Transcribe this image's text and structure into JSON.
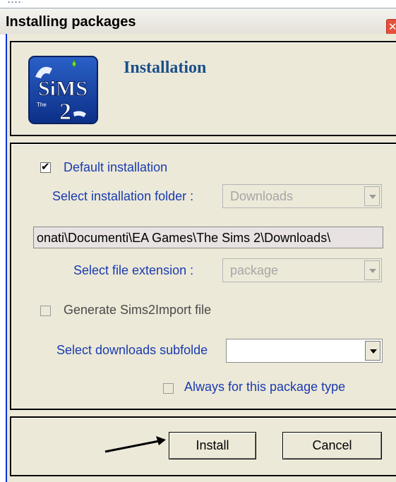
{
  "window": {
    "title": "Installing packages",
    "close_glyph": "✕"
  },
  "header": {
    "logo_text": "The Sims 2",
    "heading": "Installation"
  },
  "options": {
    "default_installation": {
      "label": "Default installation",
      "checked": true
    },
    "install_folder": {
      "label": "Select installation folder :",
      "value": "Downloads"
    },
    "path": "onati\\Documenti\\EA Games\\The Sims 2\\Downloads\\",
    "file_extension": {
      "label": "Select file extension :",
      "value": "package"
    },
    "generate_import": {
      "label": "Generate Sims2Import file",
      "checked": false
    },
    "downloads_subfolder": {
      "label": "Select downloads subfolde",
      "value": ""
    },
    "always_for_type": {
      "label": "Always for this package type",
      "checked": false
    }
  },
  "buttons": {
    "install": "Install",
    "cancel": "Cancel"
  },
  "colors": {
    "accent_label": "#1a3bb0",
    "heading": "#1a4f8a",
    "window_bg": "#ece9d8",
    "title_border": "#0831d9"
  }
}
